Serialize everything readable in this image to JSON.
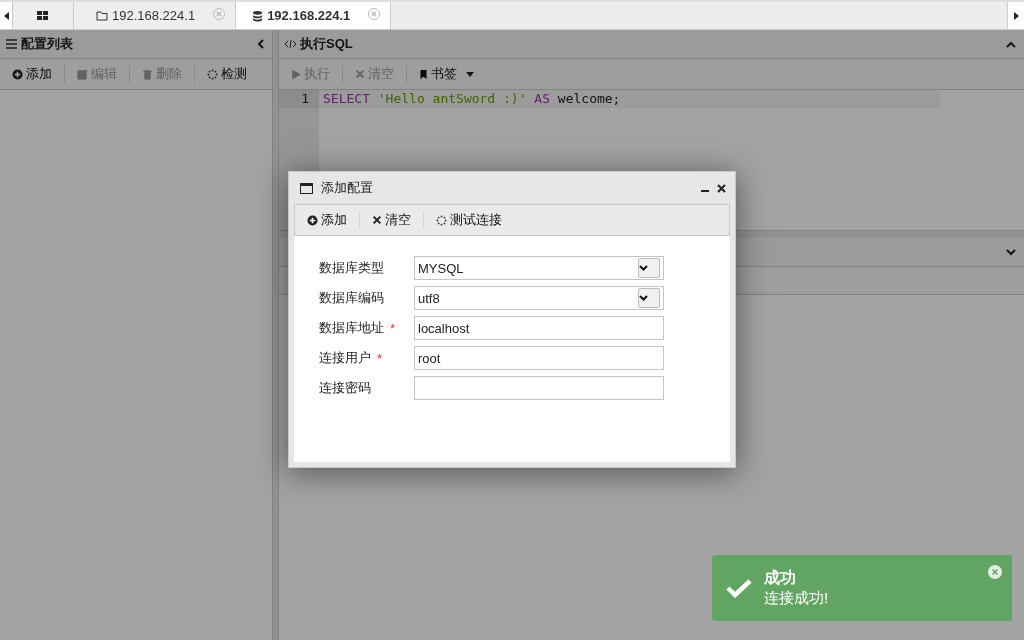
{
  "tabs": [
    {
      "kind": "home",
      "selected": false
    },
    {
      "kind": "folder",
      "label": "192.168.224.1",
      "selected": false
    },
    {
      "kind": "database",
      "label": "192.168.224.1",
      "selected": true
    }
  ],
  "left_panel": {
    "title": "配置列表",
    "toolbar": [
      {
        "kind": "add",
        "label": "添加",
        "disabled": false
      },
      {
        "kind": "edit",
        "label": "编辑",
        "disabled": true
      },
      {
        "kind": "delete",
        "label": "删除",
        "disabled": true
      },
      {
        "kind": "check",
        "label": "检测",
        "disabled": false
      }
    ]
  },
  "sql_panel": {
    "title": "执行SQL",
    "toolbar": [
      {
        "kind": "run",
        "label": "执行",
        "disabled": true
      },
      {
        "kind": "clear",
        "label": "清空",
        "disabled": true
      },
      {
        "kind": "bookmark",
        "label": "书签",
        "disabled": false
      }
    ],
    "editor": {
      "lines": [
        {
          "number": "1",
          "tokens": [
            {
              "kind": "keyword",
              "text": "SELECT"
            },
            {
              "kind": "string",
              "text": "'Hello antSword :)'"
            },
            {
              "kind": "keyword",
              "text": "AS"
            },
            {
              "kind": "plain",
              "text": "welcome;"
            }
          ]
        }
      ]
    }
  },
  "dialog": {
    "title": "添加配置",
    "toolbar": [
      {
        "kind": "add",
        "label": "添加"
      },
      {
        "kind": "clear",
        "label": "清空"
      },
      {
        "kind": "check",
        "label": "测试连接"
      }
    ],
    "fields": [
      {
        "kind": "select",
        "label": "数据库类型",
        "value": "MYSQL"
      },
      {
        "kind": "select",
        "label": "数据库编码",
        "value": "utf8"
      },
      {
        "kind": "text",
        "label": "数据库地址",
        "required_mark": "*",
        "value": "localhost"
      },
      {
        "kind": "text",
        "label": "连接用户",
        "required_mark": "*",
        "value": "root"
      },
      {
        "kind": "password",
        "label": "连接密码"
      }
    ]
  },
  "toast": {
    "title": "成功",
    "message": "连接成功!"
  }
}
